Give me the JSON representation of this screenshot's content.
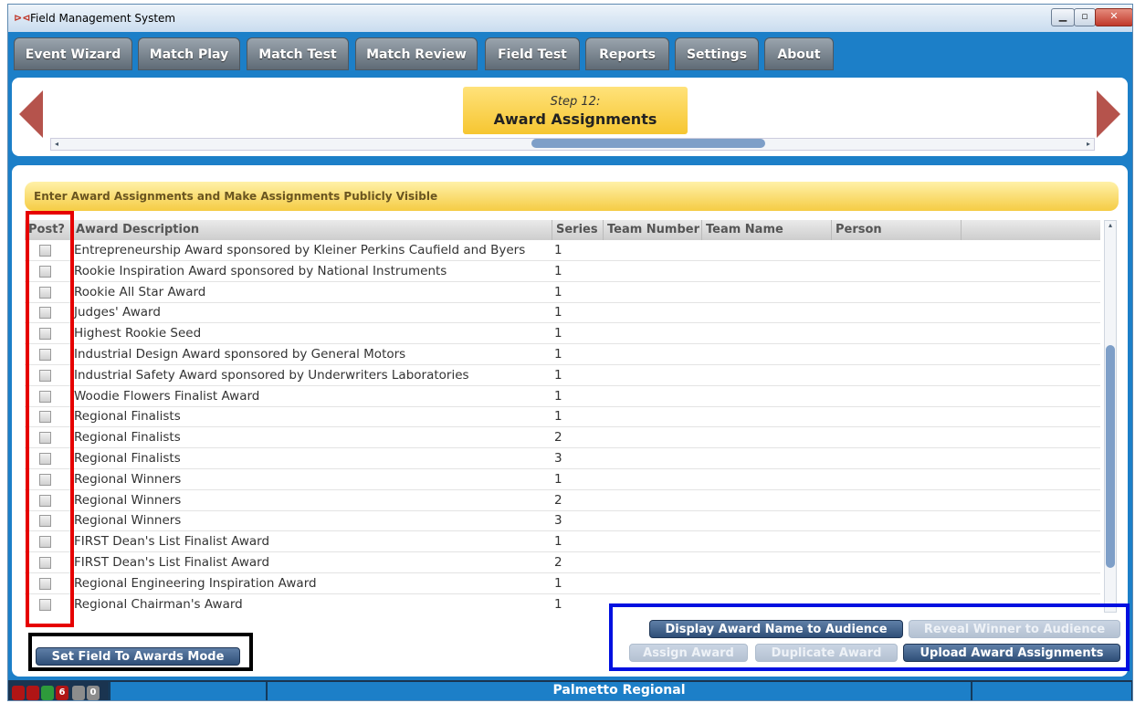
{
  "window": {
    "title": "Field Management System"
  },
  "nav_tabs": [
    {
      "label": "Event Wizard"
    },
    {
      "label": "Match Play"
    },
    {
      "label": "Match Test"
    },
    {
      "label": "Match Review"
    },
    {
      "label": "Field Test"
    },
    {
      "label": "Reports"
    },
    {
      "label": "Settings"
    },
    {
      "label": "About"
    }
  ],
  "wizard": {
    "current_step_num": "Step 12:",
    "current_step_label": "Award Assignments"
  },
  "banner_text": "Enter Award Assignments and Make Assignments Publicly Visible",
  "table": {
    "columns": [
      "Post?",
      "Award Description",
      "Series",
      "Team Number",
      "Team Name",
      "Person"
    ],
    "rows": [
      {
        "desc": "Entrepreneurship Award sponsored by Kleiner Perkins Caufield and Byers",
        "series": "1"
      },
      {
        "desc": "Rookie Inspiration Award sponsored by National Instruments",
        "series": "1"
      },
      {
        "desc": "Rookie All Star Award",
        "series": "1"
      },
      {
        "desc": "Judges' Award",
        "series": "1"
      },
      {
        "desc": "Highest Rookie Seed",
        "series": "1"
      },
      {
        "desc": "Industrial Design Award sponsored by General Motors",
        "series": "1"
      },
      {
        "desc": "Industrial Safety Award sponsored by Underwriters Laboratories",
        "series": "1"
      },
      {
        "desc": "Woodie Flowers Finalist Award",
        "series": "1"
      },
      {
        "desc": "Regional Finalists",
        "series": "1"
      },
      {
        "desc": "Regional Finalists",
        "series": "2"
      },
      {
        "desc": "Regional Finalists",
        "series": "3"
      },
      {
        "desc": "Regional Winners",
        "series": "1"
      },
      {
        "desc": "Regional Winners",
        "series": "2"
      },
      {
        "desc": "Regional Winners",
        "series": "3"
      },
      {
        "desc": "FIRST Dean's List Finalist Award",
        "series": "1"
      },
      {
        "desc": "FIRST Dean's List Finalist Award",
        "series": "2"
      },
      {
        "desc": "Regional Engineering Inspiration Award",
        "series": "1"
      },
      {
        "desc": "Regional Chairman's Award",
        "series": "1"
      }
    ]
  },
  "buttons": {
    "set_field": "Set Field To Awards Mode",
    "display_award": "Display Award Name to Audience",
    "reveal_winner": "Reveal Winner to Audience",
    "assign_award": "Assign Award",
    "duplicate_award": "Duplicate Award",
    "upload_assignments": "Upload Award Assignments"
  },
  "status": {
    "event_name": "Palmetto Regional",
    "indicator_count": "6",
    "indicator_zero": "0"
  },
  "colors": {
    "accent": "#1c7fc8",
    "banner": "#f5cc44",
    "highlight_red": "#e60000",
    "highlight_blue": "#0010e0"
  }
}
